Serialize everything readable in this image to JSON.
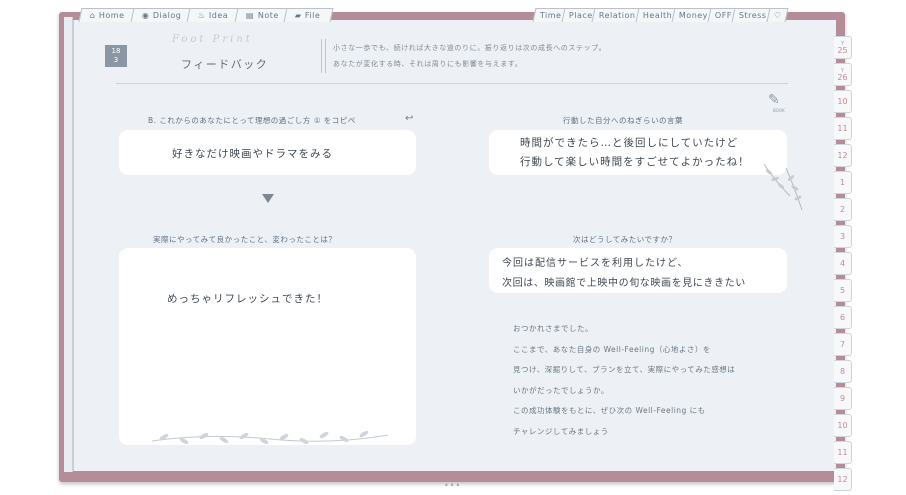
{
  "tabs_left": [
    {
      "icon": "home-icon",
      "glyph": "⌂",
      "label": "Home"
    },
    {
      "icon": "dialog-icon",
      "glyph": "◉",
      "label": "Dialog"
    },
    {
      "icon": "idea-icon",
      "glyph": "♨",
      "label": "Idea"
    },
    {
      "icon": "note-icon",
      "glyph": "▤",
      "label": "Note"
    },
    {
      "icon": "file-icon",
      "glyph": "▰",
      "label": "File"
    }
  ],
  "tabs_right": [
    {
      "label": "Time"
    },
    {
      "label": "Place"
    },
    {
      "label": "Relation"
    },
    {
      "label": "Health"
    },
    {
      "label": "Money"
    },
    {
      "label": "OFF"
    },
    {
      "label": "Stress"
    },
    {
      "label": "♡"
    }
  ],
  "months": [
    {
      "label": "25",
      "year": "Y"
    },
    {
      "label": "26",
      "year": "Y"
    },
    {
      "label": "10",
      "year": ""
    },
    {
      "label": "11",
      "year": ""
    },
    {
      "label": "12",
      "year": ""
    },
    {
      "label": "1",
      "year": ""
    },
    {
      "label": "2",
      "year": ""
    },
    {
      "label": "3",
      "year": ""
    },
    {
      "label": "4",
      "year": ""
    },
    {
      "label": "5",
      "year": ""
    },
    {
      "label": "6",
      "year": ""
    },
    {
      "label": "7",
      "year": ""
    },
    {
      "label": "8",
      "year": ""
    },
    {
      "label": "9",
      "year": ""
    },
    {
      "label": "10",
      "year": ""
    },
    {
      "label": "11",
      "year": ""
    },
    {
      "label": "12",
      "year": ""
    }
  ],
  "header": {
    "date_day": "18",
    "date_month": "3",
    "script_title": "Foot Print",
    "title": "フィードバック",
    "motto_line1": "小さな一歩でも、続ければ大きな道のりに。振り返りは次の成長へのステップ。",
    "motto_line2": "あなたが変化する時、それは周りにも影響を与えます。",
    "book_icon_label": "BOOK"
  },
  "section_b": {
    "question": "B. これからのあなたにとって理想の過ごし方 ① をコピペ",
    "answer": "好きなだけ映画やドラマをみる"
  },
  "section_action": {
    "question": "行動した自分へのねぎらいの言葉",
    "line1": "時間ができたら…と後回しにしていたけど",
    "line2": "行動して楽しい時間をすごせてよかったね！"
  },
  "section_result": {
    "question": "実際にやってみて良かったこと、変わったことは？",
    "answer": "めっちゃリフレッシュできた！"
  },
  "section_next": {
    "question": "次はどうしてみたいですか？",
    "line1": "今回は配信サービスを利用したけど、",
    "line2": "次回は、映画館で上映中の旬な映画を見にききたい"
  },
  "closing": [
    "おつかれさまでした。",
    "ここまで、あなた自身の Well-Feeling（心地よさ）を",
    "見つけ、深掘りして、プランを立て、実際にやってみた感想は",
    "いかがだったでしょうか。",
    "この成功体験をもとに、ぜひ次の Well-Feeling にも",
    "チャレンジしてみましょう"
  ],
  "bottom_handle": "•••",
  "colors": {
    "frame": "#b58d99",
    "page": "#edf1f5",
    "month_text": "#c48a98",
    "badge": "#8a96a3"
  }
}
